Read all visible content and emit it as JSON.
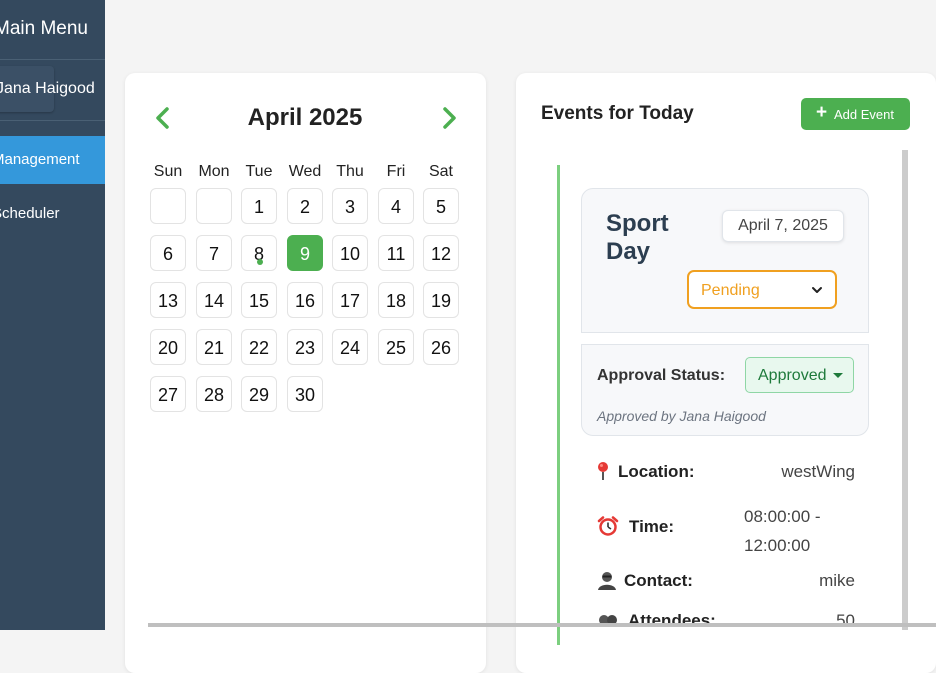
{
  "sidebar": {
    "title": "Main Menu",
    "user": "Jana Haigood",
    "items": [
      {
        "label": "Management",
        "active": true
      },
      {
        "label": "Scheduler",
        "active": false
      }
    ]
  },
  "calendar": {
    "month_label": "April 2025",
    "weekdays": [
      "Sun",
      "Mon",
      "Tue",
      "Wed",
      "Thu",
      "Fri",
      "Sat"
    ],
    "leading_blanks": 2,
    "days": [
      "1",
      "2",
      "3",
      "4",
      "5",
      "6",
      "7",
      "8",
      "9",
      "10",
      "11",
      "12",
      "13",
      "14",
      "15",
      "16",
      "17",
      "18",
      "19",
      "20",
      "21",
      "22",
      "23",
      "24",
      "25",
      "26",
      "27",
      "28",
      "29",
      "30"
    ],
    "selected_day": "9",
    "days_with_events": [
      "8"
    ],
    "accent_color": "#4caf50"
  },
  "events": {
    "heading": "Events for Today",
    "add_button_label": "Add Event",
    "items": [
      {
        "name": "Sport Day",
        "date": "April 7, 2025",
        "status": "Pending",
        "approval_label": "Approval Status:",
        "approval_value": "Approved",
        "approved_by": "Approved by Jana Haigood",
        "location_label": "Location:",
        "location": "westWing",
        "time_label": "Time:",
        "time": "08:00:00 - 12:00:00",
        "contact_label": "Contact:",
        "contact": "mike",
        "attendees_label": "Attendees:",
        "attendees": "50"
      }
    ]
  },
  "colors": {
    "sidebar_bg": "#34495e",
    "sidebar_active": "#3498db",
    "pending": "#f0a020",
    "approved_bg": "#e8f8ee",
    "approved_text": "#1e7a3b"
  }
}
